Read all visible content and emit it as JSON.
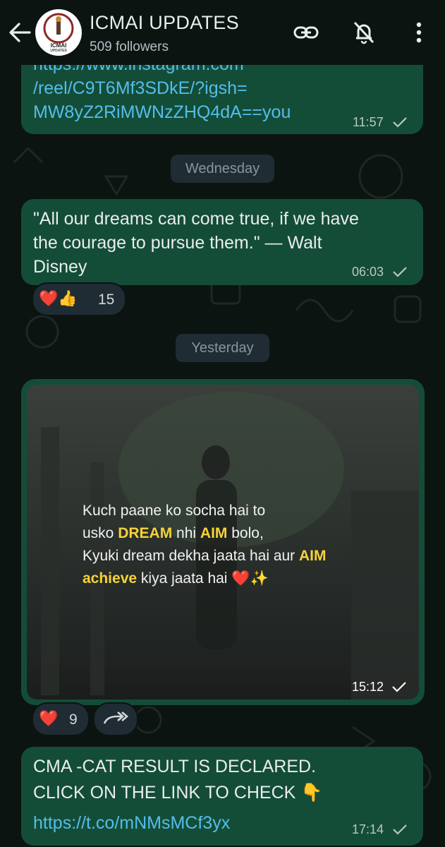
{
  "header": {
    "title": "ICMAI UPDATES",
    "followers": "509 followers",
    "avatar_text": "ICMAI",
    "avatar_sub": "UPDATES"
  },
  "messages": [
    {
      "link_lines": [
        "https://www.instagram.com",
        "/reel/C9T6Mf3SDkE/?igsh=",
        "MW8yZ2RiMWNzZHQ4dA==you"
      ],
      "time": "11:57"
    },
    {
      "date_label": "Wednesday",
      "text_lines": [
        "\"All our dreams can come true, if we have",
        "the courage to pursue them.\" — Walt",
        "Disney"
      ],
      "time": "06:03",
      "reactions": {
        "emojis": "❤️👍",
        "count": "15"
      }
    },
    {
      "date_label": "Yesterday",
      "image_quote": {
        "line1": "Kuch paane ko socha hai to",
        "line2_a": "usko ",
        "line2_b": "DREAM",
        "line2_c": " nhi ",
        "line2_d": "AIM",
        "line2_e": " bolo,",
        "line3_a": "Kyuki dream dekha jaata hai aur ",
        "line3_b": "AIM",
        "line4_a": "achieve",
        "line4_b": " kiya jaata hai ❤️✨"
      },
      "time": "15:12",
      "reactions": {
        "emojis": "❤️",
        "count": "9"
      }
    },
    {
      "text_lines": [
        "CMA -CAT RESULT IS DECLARED.",
        "CLICK ON THE LINK TO CHECK 👇"
      ],
      "link": "https://t.co/mNMsMCf3yx",
      "time": "17:14"
    }
  ]
}
